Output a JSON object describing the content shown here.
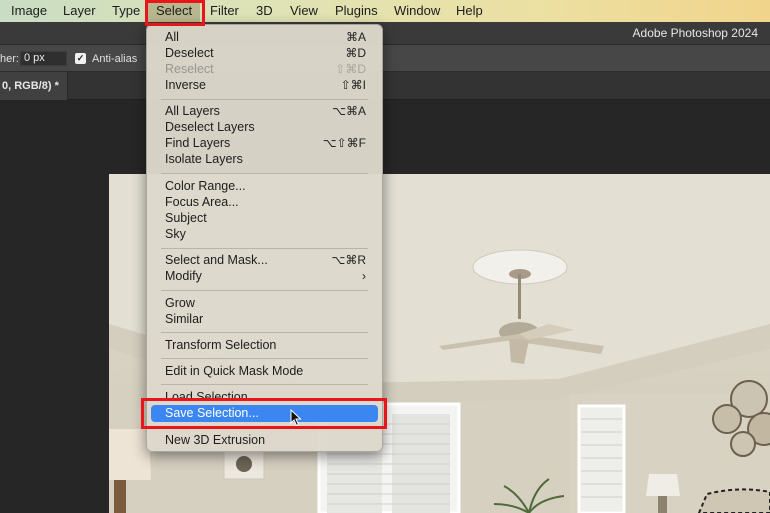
{
  "menubar": {
    "items": [
      {
        "label": "Image"
      },
      {
        "label": "Layer"
      },
      {
        "label": "Type"
      },
      {
        "label": "Select",
        "active": true
      },
      {
        "label": "Filter"
      },
      {
        "label": "3D"
      },
      {
        "label": "View"
      },
      {
        "label": "Plugins"
      },
      {
        "label": "Window"
      },
      {
        "label": "Help"
      }
    ]
  },
  "titlebar": {
    "app_title": "Adobe Photoshop 2024"
  },
  "options": {
    "feather_label": "her:",
    "feather_value": "0 px",
    "anti_alias_label": "Anti-alias",
    "anti_alias_checked": true
  },
  "document_tab": {
    "label": "0, RGB/8) *"
  },
  "select_menu": {
    "groups": [
      [
        {
          "label": "All",
          "shortcut": "⌘A"
        },
        {
          "label": "Deselect",
          "shortcut": "⌘D"
        },
        {
          "label": "Reselect",
          "shortcut": "⇧⌘D",
          "disabled": true
        },
        {
          "label": "Inverse",
          "shortcut": "⇧⌘I"
        }
      ],
      [
        {
          "label": "All Layers",
          "shortcut": "⌥⌘A"
        },
        {
          "label": "Deselect Layers",
          "shortcut": ""
        },
        {
          "label": "Find Layers",
          "shortcut": "⌥⇧⌘F"
        },
        {
          "label": "Isolate Layers",
          "shortcut": ""
        }
      ],
      [
        {
          "label": "Color Range...",
          "shortcut": ""
        },
        {
          "label": "Focus Area...",
          "shortcut": ""
        },
        {
          "label": "Subject",
          "shortcut": ""
        },
        {
          "label": "Sky",
          "shortcut": ""
        }
      ],
      [
        {
          "label": "Select and Mask...",
          "shortcut": "⌥⌘R"
        },
        {
          "label": "Modify",
          "shortcut": "›",
          "submenu": true
        }
      ],
      [
        {
          "label": "Grow",
          "shortcut": ""
        },
        {
          "label": "Similar",
          "shortcut": ""
        }
      ],
      [
        {
          "label": "Transform Selection",
          "shortcut": ""
        }
      ],
      [
        {
          "label": "Edit in Quick Mask Mode",
          "shortcut": ""
        }
      ],
      [
        {
          "label": "Load Selection...",
          "shortcut": ""
        },
        {
          "label": "Save Selection...",
          "shortcut": "",
          "highlighted": true
        }
      ],
      [
        {
          "label": "New 3D Extrusion",
          "shortcut": ""
        }
      ]
    ]
  },
  "colors": {
    "highlight": "#3b86f0",
    "annotation_red": "#e8161b"
  }
}
